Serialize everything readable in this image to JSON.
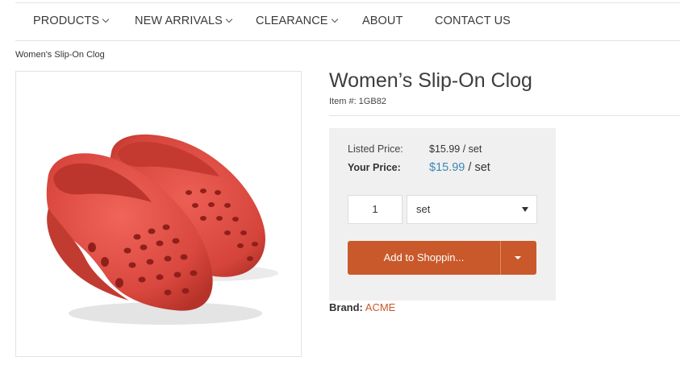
{
  "nav": {
    "items": [
      {
        "label": "PRODUCTS",
        "has_menu": true
      },
      {
        "label": "NEW ARRIVALS",
        "has_menu": true
      },
      {
        "label": "CLEARANCE",
        "has_menu": true
      },
      {
        "label": "ABOUT",
        "has_menu": false
      },
      {
        "label": "CONTACT US",
        "has_menu": false
      }
    ]
  },
  "breadcrumb": "Women's Slip-On Clog",
  "product": {
    "image_icon": "red-clogs-photo",
    "title": "Women’s Slip-On Clog",
    "item_number": "Item #: 1GB82"
  },
  "pricing": {
    "listed_label": "Listed Price:",
    "listed_value": "$15.99 / set",
    "your_label": "Your Price:",
    "your_amount": "$15.99",
    "your_unit": " / set",
    "accent_color": "#3b86b5"
  },
  "purchase": {
    "quantity": "1",
    "unit": "set",
    "add_label": "Add to Shoppin...",
    "button_color": "#c9592a"
  },
  "brand": {
    "label": "Brand:",
    "value": "ACME"
  }
}
